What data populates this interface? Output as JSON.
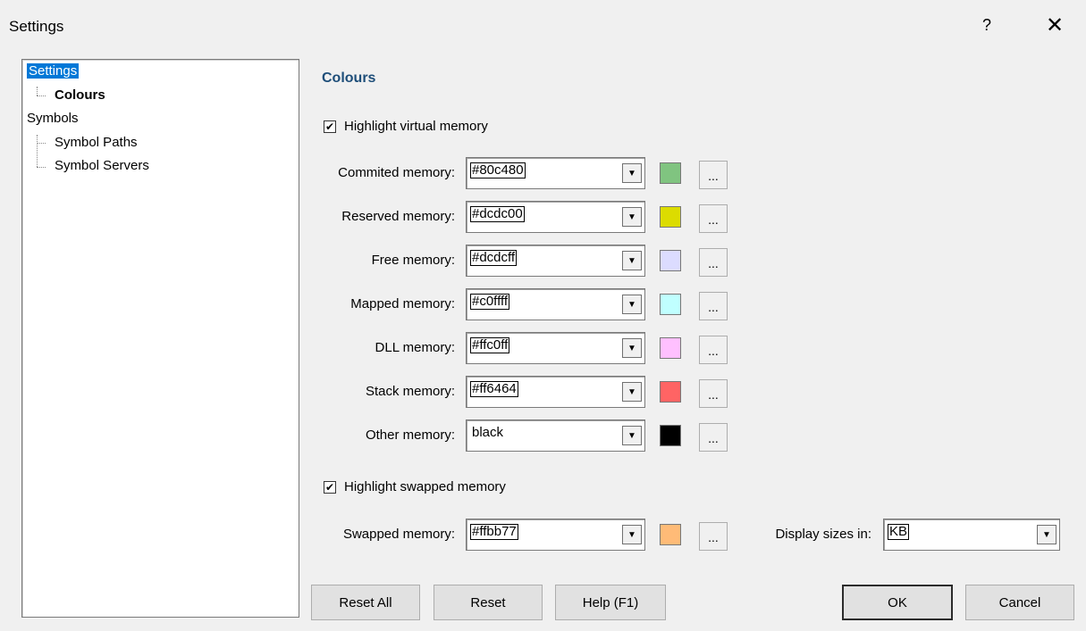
{
  "window": {
    "title": "Settings",
    "help_glyph": "?",
    "close_glyph": "✕"
  },
  "tree": {
    "items": [
      {
        "label": "Settings",
        "selected": true
      },
      {
        "label": "Colours",
        "bold": true
      },
      {
        "label": "Symbols"
      },
      {
        "label": "Symbol Paths"
      },
      {
        "label": "Symbol Servers"
      }
    ]
  },
  "section_title": "Colours",
  "highlight_virtual": {
    "label": "Highlight virtual memory",
    "checked": true,
    "mark": "✔"
  },
  "colours": [
    {
      "label": "Commited memory:",
      "value": "#80c480",
      "color": "#80c480"
    },
    {
      "label": "Reserved memory:",
      "value": "#dcdc00",
      "color": "#dcdc00"
    },
    {
      "label": "Free memory:",
      "value": "#dcdcff",
      "color": "#dcdcff"
    },
    {
      "label": "Mapped memory:",
      "value": "#c0ffff",
      "color": "#c0ffff"
    },
    {
      "label": "DLL memory:",
      "value": "#ffc0ff",
      "color": "#ffc0ff"
    },
    {
      "label": "Stack memory:",
      "value": "#ff6464",
      "color": "#ff6464"
    },
    {
      "label": "Other memory:",
      "value": "black",
      "color": "#000000"
    }
  ],
  "highlight_swapped": {
    "label": "Highlight swapped memory",
    "checked": true,
    "mark": "✔"
  },
  "swapped": {
    "label": "Swapped memory:",
    "value": "#ffbb77",
    "color": "#ffbb77"
  },
  "display_sizes": {
    "label": "Display sizes in:",
    "value": "KB"
  },
  "picker_label": "...",
  "arrow_glyph": "▼",
  "buttons": {
    "reset_all": "Reset All",
    "reset": "Reset",
    "help": "Help (F1)",
    "ok": "OK",
    "cancel": "Cancel"
  }
}
